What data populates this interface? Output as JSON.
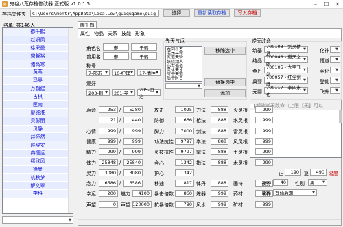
{
  "window": {
    "title": "鬼谷八荒存档修改器 正式版 v1.0.1.5"
  },
  "toolbar": {
    "path_label": "存档文件夹",
    "path_value": "C:\\Users\\montr\\AppData\\LocalLow\\guigugame\\guig",
    "choose_btn": "选择",
    "reread_btn": "重新读取存档",
    "write_btn": "写入存档"
  },
  "namelist": {
    "header": "名单: 共146人",
    "items": [
      "御千鹤",
      "赵识凤",
      "徐采曼",
      "常紫裕",
      "诸高寒",
      "黄苇",
      "冯奥",
      "万鹤建",
      "古棋",
      "匡南",
      "廖雅淮",
      "贝彭丽",
      "贝静",
      "赵怀然",
      "赵醉安",
      "冉悟远",
      "缪欣风",
      "徐曼",
      "杭秋梦",
      "解文翠",
      "李科"
    ]
  },
  "panel": {
    "title": "御千鹤",
    "tabs": [
      "属性",
      "物品",
      "关系",
      "技能",
      "形象"
    ]
  },
  "basic": {
    "name_label": "角色名",
    "name1": "御",
    "name2": "千鹤",
    "oldname_label": "曾用名",
    "oldname1": "御",
    "oldname2": "千鹤",
    "title_label": "称号",
    "sect": "7-部态",
    "rank": "10-护理",
    "pos": "17-情种",
    "hobby_label": "爱好",
    "hobby1": "203-刺",
    "hobby2": "201-英",
    "hobby3": "205-团治"
  },
  "innate": {
    "title": "先天气运",
    "items": [
      "天剑斗者",
      "混元立命",
      "武道天骄",
      "妖娆动人",
      "心若遁道",
      "灵体天才",
      "应帝天道",
      "后帝时日"
    ],
    "remove_btn": "移除选中",
    "replace_btn": "替换选中",
    "add_btn": "添加"
  },
  "destiny": {
    "title": "逆天改命",
    "rows": [
      {
        "k1": "筑基",
        "v1": "700103 - 剑灵精通",
        "k2": "化神"
      },
      {
        "k1": "结晶",
        "v1": "700048 - 道天之眼",
        "k2": "悟道"
      },
      {
        "k1": "金丹",
        "v1": "700105 - 大宇飞剑",
        "k2": "羽化"
      },
      {
        "k1": "具婴",
        "v1": "700057 - 红尘剑魂",
        "k2": "登仙"
      },
      {
        "k1": "元婴",
        "v1": "700117 - 李四来也",
        "k2": "飞升"
      }
    ],
    "extra_label": "额外逆天改命（上限【无】可以"
  },
  "stats": [
    {
      "l": "寿命",
      "a": "253",
      "b": "5280"
    },
    {
      "l": "",
      "a": "21",
      "b": "440"
    },
    {
      "l": "心情",
      "a": "999",
      "b": "999"
    },
    {
      "l": "健康",
      "a": "999",
      "b": "999"
    },
    {
      "l": "精力",
      "a": "999",
      "b": "999"
    },
    {
      "l": "体力",
      "a": "25848",
      "b": "25840"
    },
    {
      "l": "灵力",
      "a": "3080",
      "b": "3080"
    },
    {
      "l": "念力",
      "a": "6586",
      "b": "6586"
    },
    {
      "l": "幸运",
      "a": "200",
      "b": ""
    },
    {
      "l": "声望",
      "a": "0",
      "b": ""
    }
  ],
  "stats_extra": {
    "luck_label2": "魅力",
    "luck_val2": "4100",
    "fame_label2": "声望",
    "fame_val2": "120000"
  },
  "combat": [
    {
      "l": "攻击",
      "v": "1025",
      "l2": "刀法",
      "v2": "888",
      "l3": "火灵根",
      "v3": "999"
    },
    {
      "l": "防御",
      "v": "666",
      "l2": "枪法",
      "v2": "888",
      "l3": "水灵根",
      "v3": "999"
    },
    {
      "l": "脚力",
      "v": "7000",
      "l2": "剑法",
      "v2": "888",
      "l3": "雷灵根",
      "v3": "999"
    },
    {
      "l": "功法抗性",
      "v": "9797",
      "l2": "拳法",
      "v2": "888",
      "l3": "风灵根",
      "v3": "999"
    },
    {
      "l": "灵技抗性",
      "v": "9797",
      "l2": "掌法",
      "v2": "888",
      "l3": "土灵根",
      "v3": "999"
    },
    {
      "l": "会心",
      "v": "1342",
      "l2": "指法",
      "v2": "888",
      "l3": "木灵根",
      "v3": "999"
    },
    {
      "l": "护心",
      "v": "1342",
      "l2": "",
      "v2": "",
      "l3": "",
      "v3": ""
    },
    {
      "l": "移速",
      "v": "817",
      "l2": "体丹",
      "v2": "888",
      "l3": "画符",
      "v3": "999"
    },
    {
      "l": "暴击倍数",
      "v": "860",
      "l2": "炼器",
      "v2": "999",
      "l3": "药材",
      "v3": "999"
    },
    {
      "l": "抗暴倍数",
      "v": "790",
      "l2": "风水",
      "v2": "999",
      "l3": "矿材",
      "v3": "999"
    }
  ],
  "right": {
    "age_label": "正",
    "age1": "190",
    "age2_label": "复",
    "age2": "490",
    "race": "潜度",
    "vision_label": "视野",
    "vision": "40",
    "gender_label": "性别",
    "gender": "男",
    "realm_label": "境界",
    "realm": "登仙后期"
  }
}
